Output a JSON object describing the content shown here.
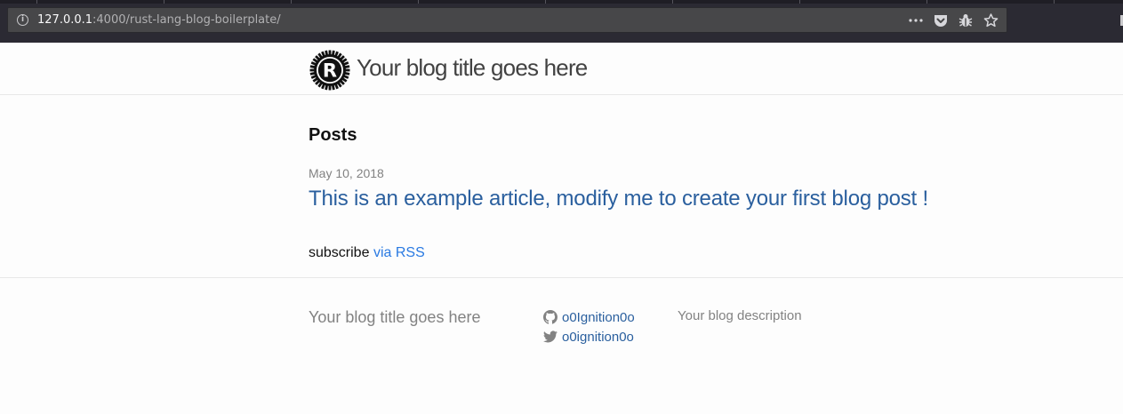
{
  "browser": {
    "url_host": "127.0.0.1",
    "url_rest": ":4000/rust-lang-blog-boilerplate/",
    "actions": [
      "more-actions-icon",
      "pocket-icon",
      "bug-icon",
      "bookmark-star-icon"
    ]
  },
  "header": {
    "logo_letter": "R",
    "title": "Your blog title goes here"
  },
  "main": {
    "posts_heading": "Posts",
    "posts": [
      {
        "date": "May 10, 2018",
        "title": "This is an example article, modify me to create your first blog post !"
      }
    ],
    "subscribe_text": "subscribe",
    "subscribe_link": "via RSS"
  },
  "footer": {
    "title": "Your blog title goes here",
    "github_user": "o0Ignition0o",
    "twitter_user": "o0ignition0o",
    "description": "Your blog description"
  },
  "colors": {
    "link": "#2a5f9e",
    "rss_link": "#2a7ae2",
    "muted": "#828282",
    "chrome": "#2b2a33"
  }
}
